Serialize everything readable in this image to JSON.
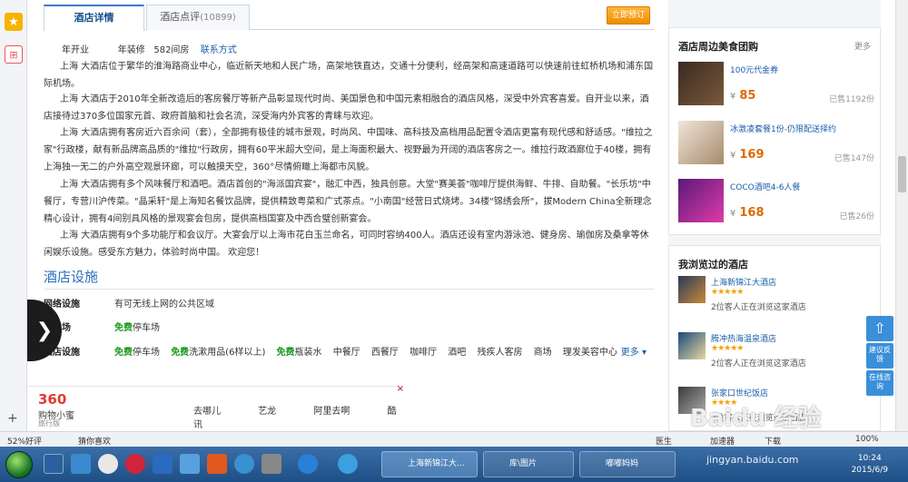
{
  "tabs": [
    {
      "label": "酒店详情"
    },
    {
      "label": "酒店点评",
      "count": "(10899)"
    }
  ],
  "book_button": "立即预订",
  "meta": {
    "opened": "年开业",
    "renovated": "年装修",
    "rooms": "582间房",
    "contact": "联系方式"
  },
  "description": [
    "上海 大酒店位于繁华的淮海路商业中心，临近新天地和人民广场，高架地铁直达，交通十分便利，经高架和高速道路可以快速前往虹桥机场和浦东国际机场。",
    "上海 大酒店于2010年全新改造后的客房餐厅等新产品彰显现代时尚、美国景色和中国元素相融合的酒店风格，深受中外宾客喜爱。自开业以来，酒店接待过370多位国家元首、政府首脑和社会名流，深受海内外宾客的青睐与欢迎。",
    "上海 大酒店拥有客房近六百余间（套），全部拥有极佳的城市景观，时尚风、中国味、高科技及高档用品配置令酒店更富有现代感和舒适感。\"维拉之家\"行政楼，献有新品牌高品质的\"维拉\"行政房，拥有60平米超大空间，是上海面积最大、视野最为开阔的酒店客房之一。维拉行政酒廊位于40楼，拥有上海独一无二的户外高空观景环廊，可以触摸天空，360°尽情俯瞰上海都市风貌。",
    "上海 大酒店拥有多个风味餐厅和酒吧。酒店首创的\"海派国宾宴\"，融汇中西，独具创意。大堂\"赛美荟\"咖啡厅提供海鲜、牛排、自助餐。\"长乐坊\"中餐厅，专营川沪传菜。\"晶采轩\"是上海知名餐饮品牌，提供精致粤菜和广式茶点。\"小南国\"经营日式烧烤。34楼\"锦绣会所\"，拔Modern China全新理念精心设计，拥有4间别具风格的景观宴会包房，提供高档国宴及中西合璧创新宴会。",
    "上海 大酒店拥有9个多功能厅和会议厅。大宴会厅以上海市花白玉兰命名，可同时容纳400人。酒店还设有室内游泳池、健身房、瑜伽房及桑拿等休闲娱乐设施。感受东方魅力，体验时尚中国。 欢迎您！"
  ],
  "facilities": {
    "title": "酒店设施",
    "network": {
      "label": "网络设施",
      "value": "有可无线上网的公共区域"
    },
    "parking": {
      "label": "停车场",
      "free": "免费",
      "value": "停车场"
    },
    "hotel": {
      "label": "酒店设施",
      "items": [
        {
          "free": "免费",
          "text": "停车场"
        },
        {
          "free": "免费",
          "text": "洗漱用品(6样以上)"
        },
        {
          "free": "免费",
          "text": "瓶装水"
        },
        {
          "free": "",
          "text": "中餐厅"
        },
        {
          "free": "",
          "text": "西餐厅"
        },
        {
          "free": "",
          "text": "咖啡厅"
        },
        {
          "free": "",
          "text": "酒吧"
        },
        {
          "free": "",
          "text": "残疾人客房"
        },
        {
          "free": "",
          "text": "商场"
        },
        {
          "free": "",
          "text": "理发美容中心"
        }
      ],
      "more": "更多 ▾"
    }
  },
  "ad": {
    "logo": "360",
    "line1": "购物小蜜",
    "line2": "旅行版",
    "links": [
      "去哪儿",
      "艺龙",
      "阿里去啊",
      "酷讯"
    ],
    "close": "×"
  },
  "deals": {
    "title": "酒店周边美食团购",
    "more": "更多",
    "items": [
      {
        "name": "100元代金券",
        "price": "85",
        "sold": "已售1192份"
      },
      {
        "name": "冰激凌套餐1份-仍限配送择约",
        "price": "169",
        "sold": "已售147份"
      },
      {
        "name": "COCO酒吧4-6人餐",
        "price": "168",
        "sold": "已售26份"
      }
    ],
    "currency": "¥"
  },
  "viewed": {
    "title": "我浏览过的酒店",
    "items": [
      {
        "name": "上海新锦江大酒店",
        "stars": "★★★★★",
        "viewing": "2位客人正在浏览这家酒店"
      },
      {
        "name": "腾冲热海温泉酒店",
        "stars": "★★★★★",
        "viewing": "2位客人正在浏览这家酒店"
      },
      {
        "name": "张家口世纪饭店",
        "stars": "★★★★",
        "viewing": "2位客人正在浏览这家酒店"
      }
    ]
  },
  "float_buttons": {
    "top": "⇧",
    "feedback": "建议反馈",
    "consult": "在线咨询"
  },
  "statusbar": {
    "rating": "52%好评",
    "guess": "猜你喜欢",
    "doctor": "医生",
    "accelerator": "加速器",
    "download": "下载",
    "zoom": "100%"
  },
  "taskbar": {
    "tasks": [
      "上海新锦江大...",
      "库\\图片",
      "嘟嘟妈妈"
    ],
    "time": "10:24",
    "date": "2015/6/9"
  },
  "watermark": {
    "main": "Baidu 经验",
    "url": "jingyan.baidu.com"
  }
}
